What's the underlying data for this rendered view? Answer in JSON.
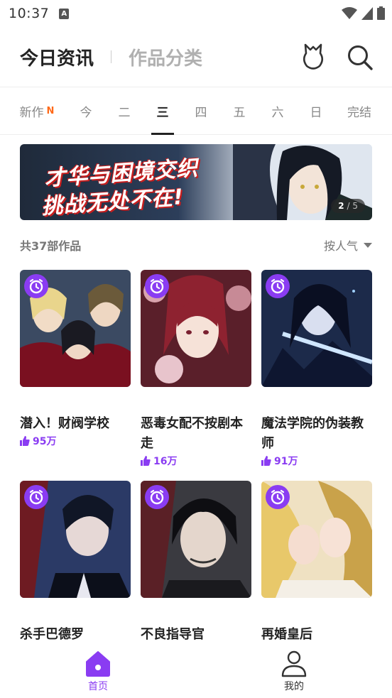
{
  "status_bar": {
    "time": "10:37",
    "notification_glyph": "A"
  },
  "header": {
    "active_tab": "今日资讯",
    "inactive_tab": "作品分类",
    "badge_icon": "badge-icon",
    "search_icon": "search-icon"
  },
  "tabs": [
    {
      "label": "新作",
      "badge": "N"
    },
    {
      "label": "今"
    },
    {
      "label": "二"
    },
    {
      "label": "三"
    },
    {
      "label": "四"
    },
    {
      "label": "五"
    },
    {
      "label": "六"
    },
    {
      "label": "日"
    },
    {
      "label": "完结"
    }
  ],
  "active_tab_index": 3,
  "banner": {
    "line1": "才华与困境交织",
    "line2": "挑战无处不在!",
    "current": "2",
    "total": "5",
    "separator": "/"
  },
  "list": {
    "count_text": "共37部作品",
    "sort_label": "按人气"
  },
  "comics": [
    {
      "title": "潜入！财阀学校",
      "likes": "95万"
    },
    {
      "title": "恶毒女配不按剧本走",
      "likes": "16万"
    },
    {
      "title": "魔法学院的伪装教师",
      "likes": "91万"
    },
    {
      "title": "杀手巴德罗",
      "likes": ""
    },
    {
      "title": "不良指导官",
      "likes": ""
    },
    {
      "title": "再婚皇后",
      "likes": ""
    }
  ],
  "bottom_nav": {
    "home_label": "首页",
    "mine_label": "我的"
  },
  "colors": {
    "accent": "#8a3cf2",
    "new_badge": "#ff6a1a"
  }
}
